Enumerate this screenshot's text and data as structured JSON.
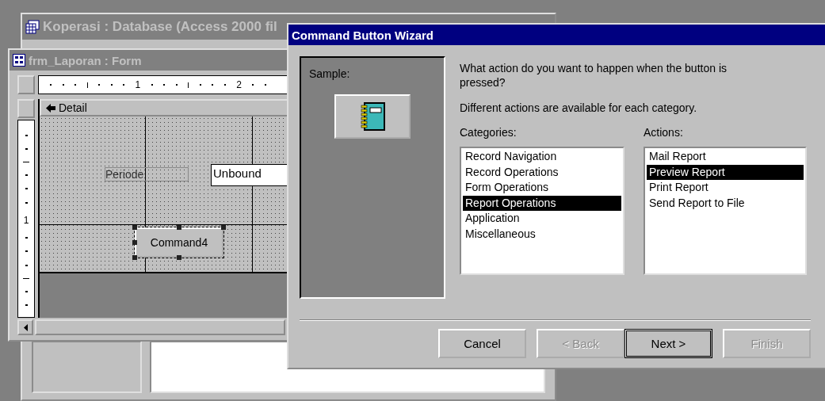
{
  "database_window": {
    "title": "Koperasi : Database (Access 2000 fil"
  },
  "form_window": {
    "title": "frm_Laporan : Form",
    "ruler_marks": [
      "1",
      "2"
    ],
    "vertical_ruler_mark": "1",
    "section": "Detail",
    "label": "Periode",
    "textbox": "Unbound",
    "command_button": {
      "label": "Command4",
      "selected": true
    }
  },
  "wizard": {
    "title": "Command Button Wizard",
    "sample_label": "Sample:",
    "question": "What action do you want to happen when the button is pressed?",
    "hint": "Different actions are available for each category.",
    "categories_label": "Categories:",
    "actions_label": "Actions:",
    "categories": [
      {
        "label": "Record Navigation",
        "selected": false
      },
      {
        "label": "Record Operations",
        "selected": false
      },
      {
        "label": "Form Operations",
        "selected": false
      },
      {
        "label": "Report Operations",
        "selected": true
      },
      {
        "label": "Application",
        "selected": false
      },
      {
        "label": "Miscellaneous",
        "selected": false
      }
    ],
    "actions": [
      {
        "label": "Mail Report",
        "selected": false
      },
      {
        "label": "Preview Report",
        "selected": true
      },
      {
        "label": "Print Report",
        "selected": false
      },
      {
        "label": "Send Report to File",
        "selected": false
      }
    ],
    "buttons": [
      {
        "label": "Cancel",
        "disabled": false,
        "default": false
      },
      {
        "label": "< Back",
        "disabled": true,
        "default": false
      },
      {
        "label": "Next >",
        "disabled": false,
        "default": true
      },
      {
        "label": "Finish",
        "disabled": true,
        "default": false
      }
    ]
  }
}
